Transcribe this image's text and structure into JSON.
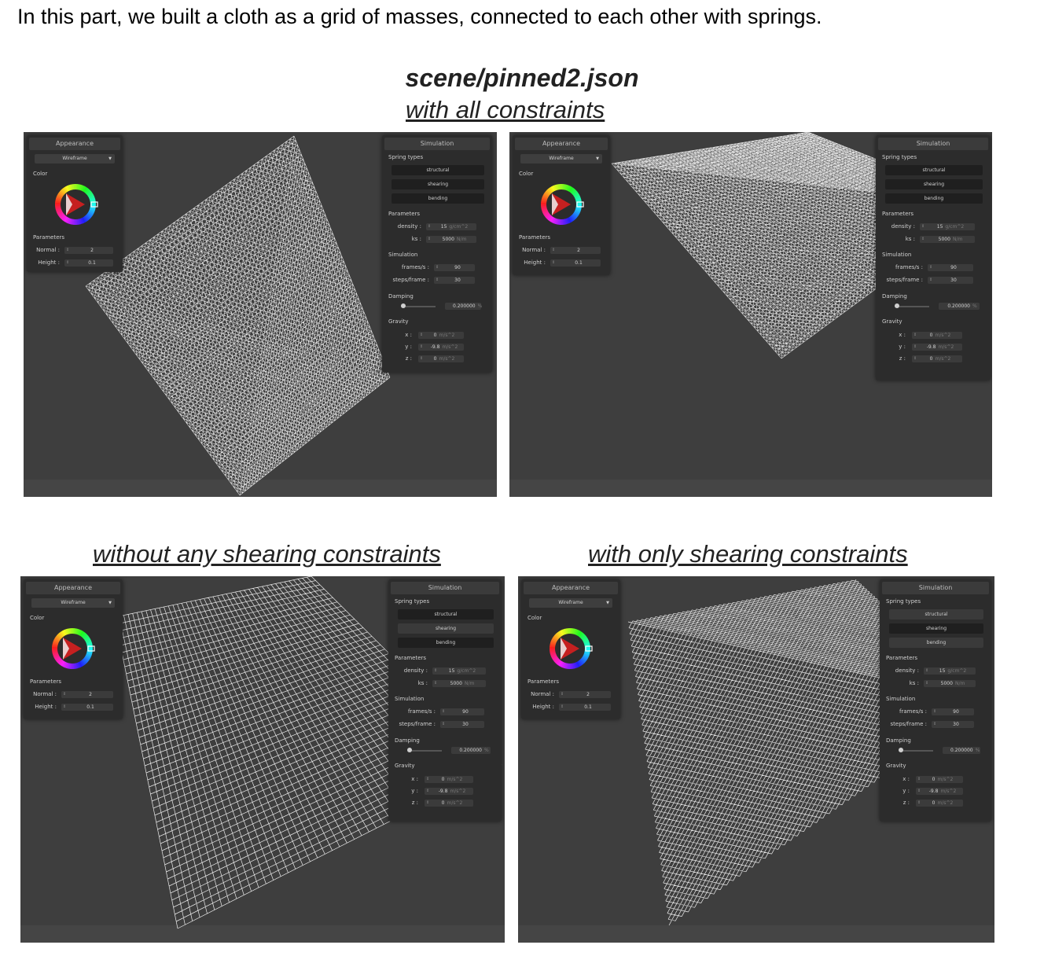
{
  "intro_text": "In this part, we built a cloth as a grid of masses, connected to each other with springs.",
  "scene_title": "scene/pinned2.json",
  "captions": {
    "all": "with all constraints",
    "no_shearing": "without any shearing constraints",
    "only_shearing": "with only shearing constraints"
  },
  "gui": {
    "appearance": {
      "title": "Appearance",
      "shader": "Wireframe",
      "color_label": "Color",
      "parameters_label": "Parameters",
      "normal_label": "Normal :",
      "normal_value": "2",
      "height_label": "Height :",
      "height_value": "0.1"
    },
    "simulation": {
      "title": "Simulation",
      "spring_types_label": "Spring types",
      "structural": "structural",
      "shearing": "shearing",
      "bending": "bending",
      "parameters_label": "Parameters",
      "density_label": "density :",
      "density_value": "15",
      "density_unit": "g/cm^2",
      "ks_label": "ks :",
      "ks_value": "5000",
      "ks_unit": "N/m",
      "simulation_label": "Simulation",
      "fps_label": "frames/s :",
      "fps_value": "90",
      "steps_label": "steps/frame :",
      "steps_value": "30",
      "damping_label": "Damping",
      "damping_value": "0.200000",
      "damping_unit": "%",
      "damping_level": 0.0,
      "gravity_label": "Gravity",
      "x_label": "x :",
      "x_value": "0",
      "y_label": "y :",
      "y_value": "-9.8",
      "z_label": "z :",
      "z_value": "0",
      "gravity_unit": "m/s^2"
    }
  },
  "screenshots": {
    "all": {
      "structural": true,
      "shearing": true,
      "bending": true
    },
    "no_shearing": {
      "structural": true,
      "shearing": false,
      "bending": true
    },
    "only_shearing": {
      "structural": false,
      "shearing": true,
      "bending": false
    }
  },
  "colors": {
    "viewport": "#3e3e3e",
    "panel": "#2c2c2c",
    "mesh": "#ffffff"
  }
}
